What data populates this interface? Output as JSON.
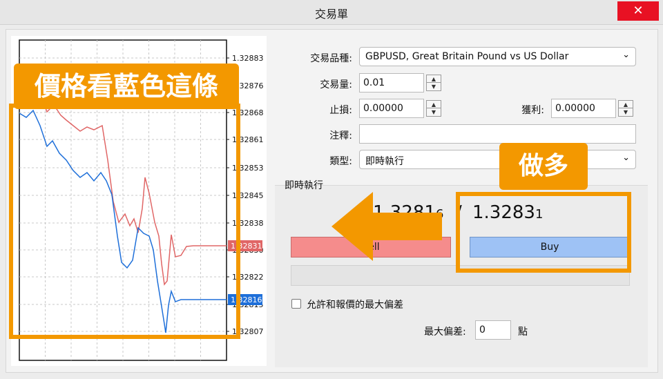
{
  "window": {
    "title": "交易單",
    "close_label": "✕"
  },
  "form": {
    "symbol_label": "交易品種:",
    "symbol_value": "GBPUSD, Great Britain Pound vs US Dollar",
    "volume_label": "交易量:",
    "volume_value": "0.01",
    "stoploss_label": "止損:",
    "stoploss_value": "0.00000",
    "takeprofit_label": "獲利:",
    "takeprofit_value": "0.00000",
    "comment_label": "注釋:",
    "comment_value": "",
    "type_label": "類型:",
    "type_value": "即時執行"
  },
  "execution": {
    "section_title": "即時執行",
    "bid_main": "1.3281",
    "bid_small": "6",
    "ask_main": "1.3283",
    "ask_small": "1",
    "separator": "/",
    "sell_label": "Sell",
    "buy_label": "Buy",
    "allow_deviation_label": "允許和報價的最大偏差",
    "max_deviation_label": "最大偏差:",
    "max_deviation_value": "0",
    "deviation_unit": "點"
  },
  "chart": {
    "y_ticks": [
      "1.32883",
      "1.32876",
      "1.32868",
      "1.32861",
      "1.32853",
      "1.32845",
      "1.32838",
      "1.32830",
      "1.32822",
      "1.32815",
      "1.32807"
    ],
    "ask_badge": "1.32831",
    "bid_badge": "1.32816",
    "ask_color": "#e06666",
    "bid_color": "#1e6fd9"
  },
  "annotations": {
    "price_note": "價格看藍色這條",
    "long_note": "做多",
    "accent_color": "#f39800"
  }
}
